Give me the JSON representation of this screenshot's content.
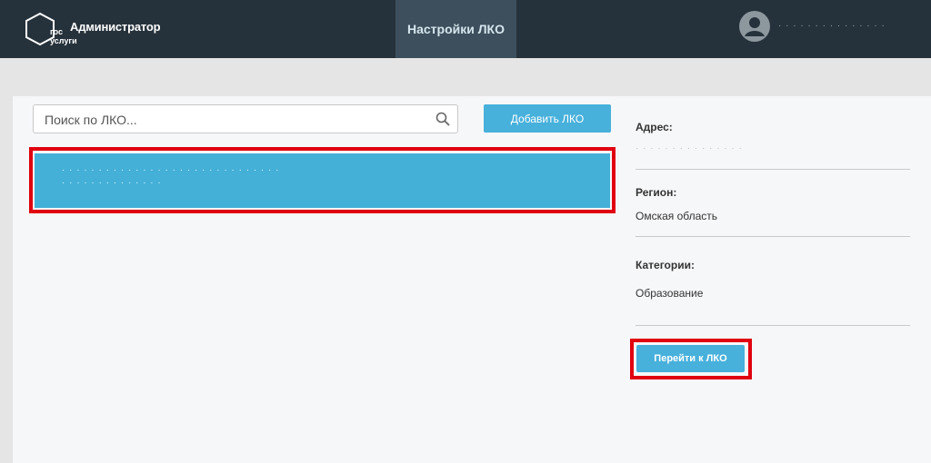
{
  "header": {
    "logo_text": "гос услуги",
    "role": "Администратор",
    "nav_tab": "Настройки ЛКО",
    "username": "· · · · · · · · · · · · · · ·"
  },
  "search": {
    "placeholder": "Поиск по ЛКО...",
    "value": ""
  },
  "toolbar": {
    "add_label": "Добавить ЛКО"
  },
  "list": {
    "items": [
      {
        "line1": "· · · · · · · · · · · · · · · · · · · · · · · · · · · · · ·",
        "line2": "· · · · · · · · · · · · · ·"
      }
    ]
  },
  "details": {
    "address_label": "Адрес:",
    "address_value": "· · · · · · · · · · · · · · ·",
    "region_label": "Регион:",
    "region_value": "Омская область",
    "categories_label": "Категории:",
    "categories_value": "Образование",
    "go_label": "Перейти к ЛКО"
  },
  "colors": {
    "topbar": "#26323b",
    "accent": "#47b0db",
    "highlight": "#e0000f"
  }
}
